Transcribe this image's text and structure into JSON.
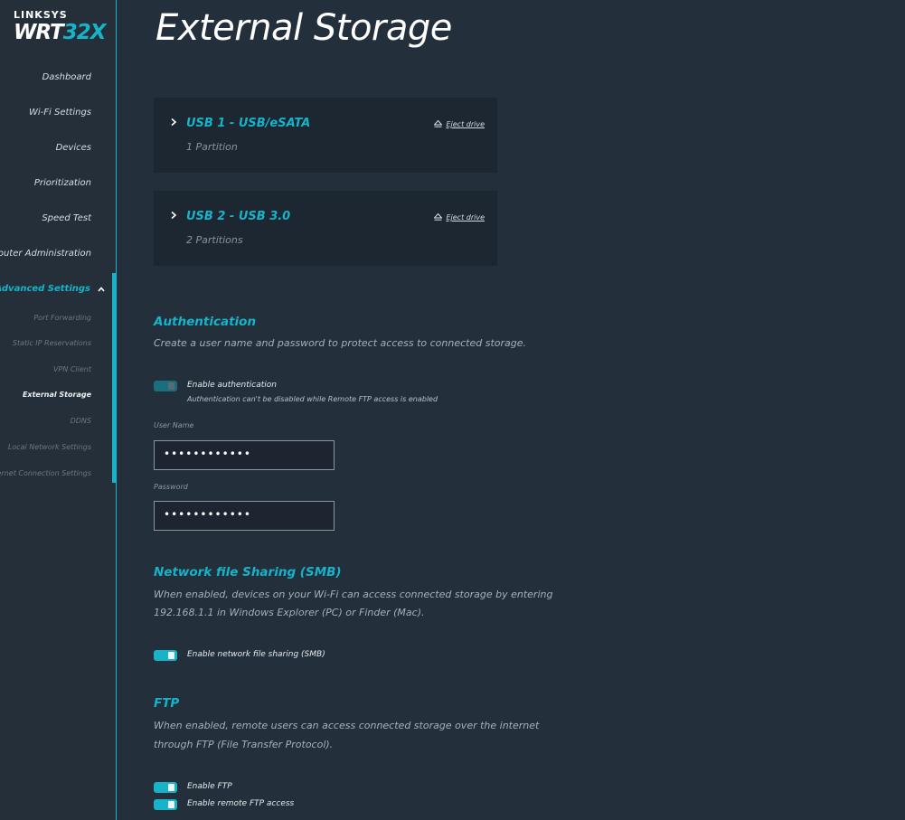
{
  "brand": {
    "company": "LINKSYS",
    "model_prefix": "WRT",
    "model_accent": "32X"
  },
  "sidebar": {
    "items": [
      {
        "label": "Dashboard"
      },
      {
        "label": "Wi-Fi Settings"
      },
      {
        "label": "Devices"
      },
      {
        "label": "Prioritization"
      },
      {
        "label": "Speed Test"
      },
      {
        "label": "Router Administration"
      },
      {
        "label": "Advanced Settings"
      }
    ],
    "sub_items": [
      {
        "label": "Port Forwarding"
      },
      {
        "label": "Static IP Reservations"
      },
      {
        "label": "VPN Client"
      },
      {
        "label": "External Storage"
      },
      {
        "label": "DDNS"
      },
      {
        "label": "Local Network Settings"
      },
      {
        "label": "Internet Connection Settings"
      }
    ]
  },
  "page": {
    "title": "External Storage"
  },
  "drives": [
    {
      "name": "USB 1 - USB/eSATA",
      "partitions": "1 Partition",
      "eject": "Eject drive"
    },
    {
      "name": "USB 2 - USB 3.0",
      "partitions": "2 Partitions",
      "eject": "Eject drive"
    }
  ],
  "auth": {
    "title": "Authentication",
    "desc": "Create a user name and password to protect access to connected storage.",
    "toggle_label": "Enable authentication",
    "toggle_note": "Authentication can't be disabled while Remote FTP access is enabled",
    "toggle_on": true,
    "username_label": "User Name",
    "username_value": "••••••••••••",
    "password_label": "Password",
    "password_value": "••••••••••••"
  },
  "smb": {
    "title": "Network file Sharing (SMB)",
    "desc_line1": "When enabled, devices on your Wi-Fi can access connected storage by entering",
    "desc_line2": "192.168.1.1 in Windows Explorer (PC) or Finder (Mac).",
    "toggle_label": "Enable network file sharing (SMB)",
    "toggle_on": true
  },
  "ftp": {
    "title": "FTP",
    "desc_line1": "When enabled, remote users can access connected storage over the internet",
    "desc_line2": "through FTP (File Transfer Protocol).",
    "toggle1_label": "Enable FTP",
    "toggle1_on": true,
    "toggle2_label": "Enable remote FTP access",
    "toggle2_on": true
  },
  "colors": {
    "accent": "#17b3c9",
    "background": "#232f3b",
    "sidebar": "#252f39",
    "card": "#1d2732"
  }
}
